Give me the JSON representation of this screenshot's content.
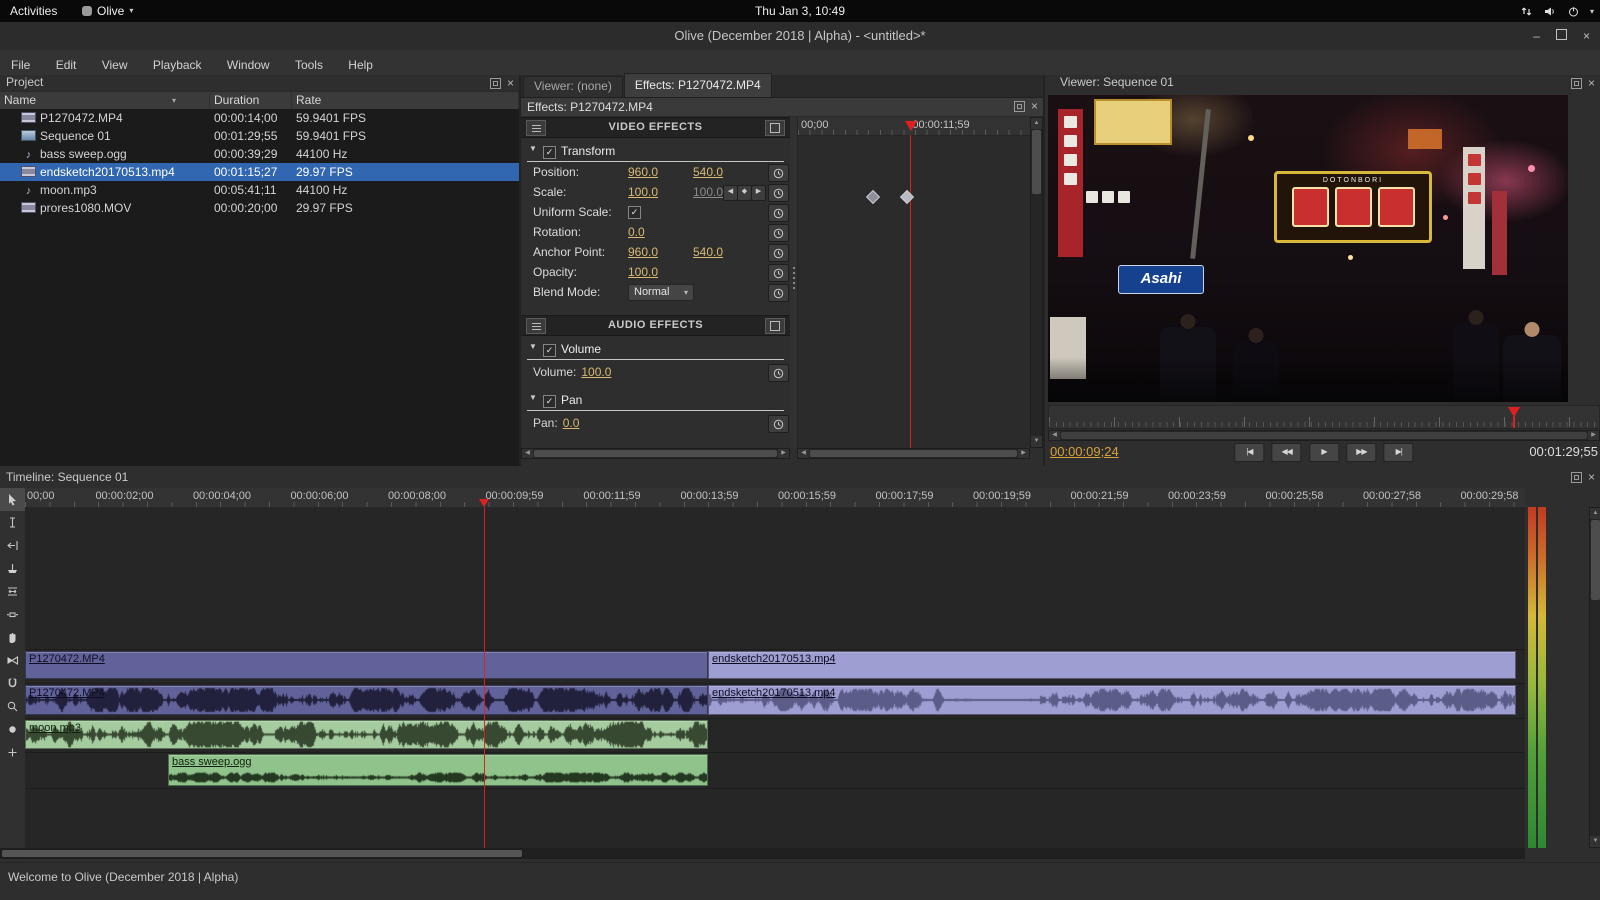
{
  "system_bar": {
    "activities_label": "Activities",
    "app_menu_label": "Olive",
    "clock": "Thu Jan 3, 10:49"
  },
  "titlebar": {
    "title": "Olive (December 2018 | Alpha) - <untitled>*"
  },
  "menu_bar": {
    "items": [
      "File",
      "Edit",
      "View",
      "Playback",
      "Window",
      "Tools",
      "Help"
    ]
  },
  "project_panel": {
    "title": "Project",
    "columns": {
      "name": "Name",
      "duration": "Duration",
      "rate": "Rate"
    },
    "items": [
      {
        "name": "P1270472.MP4",
        "duration": "00:00:14;00",
        "rate": "59.9401 FPS"
      },
      {
        "name": "Sequence 01",
        "duration": "00:01:29;55",
        "rate": "59.9401 FPS"
      },
      {
        "name": "bass sweep.ogg",
        "duration": "00:00:39;29",
        "rate": "44100 Hz"
      },
      {
        "name": "endsketch20170513.mp4",
        "duration": "00:01:15;27",
        "rate": "29.97 FPS"
      },
      {
        "name": "moon.mp3",
        "duration": "00:05:41;11",
        "rate": "44100 Hz"
      },
      {
        "name": "prores1080.MOV",
        "duration": "00:00:20;00",
        "rate": "29.97 FPS"
      }
    ],
    "selected_index": 3
  },
  "effects_panel": {
    "tabs": [
      {
        "label": "Viewer: (none)"
      },
      {
        "label": "Effects: P1270472.MP4"
      }
    ],
    "header": "Effects: P1270472.MP4",
    "video_effects_header": "VIDEO EFFECTS",
    "audio_effects_header": "AUDIO EFFECTS",
    "transform": {
      "title": "Transform",
      "position": {
        "label": "Position:",
        "x": "960.0",
        "y": "540.0"
      },
      "scale": {
        "label": "Scale:",
        "x": "100.0",
        "y": "100.0"
      },
      "uniform_scale": {
        "label": "Uniform Scale:"
      },
      "rotation": {
        "label": "Rotation:",
        "value": "0.0"
      },
      "anchor_point": {
        "label": "Anchor Point:",
        "x": "960.0",
        "y": "540.0"
      },
      "opacity": {
        "label": "Opacity:",
        "value": "100.0"
      },
      "blend_mode": {
        "label": "Blend Mode:",
        "value": "Normal"
      }
    },
    "volume": {
      "title": "Volume",
      "label": "Volume:",
      "value": "100.0"
    },
    "pan": {
      "title": "Pan",
      "label": "Pan:",
      "value": "0.0"
    },
    "keyframe_ruler": {
      "start_label": "00;00",
      "end_label": "00:00:11;59"
    }
  },
  "viewer_panel": {
    "title": "Viewer: Sequence 01",
    "current_time": "00:00:09;24",
    "total_time": "00:01:29;55",
    "transport": {
      "prev": "|◀",
      "rewind": "◀◀",
      "play": "▶",
      "forward": "▶▶",
      "next": "▶|"
    },
    "scene": {
      "sign_dotonbori": "DOTONBORI",
      "sign_asahi": "Asahi"
    }
  },
  "timeline_panel": {
    "title": "Timeline: Sequence 01",
    "ruler_labels": [
      "00;00",
      "00:00:02;00",
      "00:00:04;00",
      "00:00:06;00",
      "00:00:08;00",
      "00:00:09;59",
      "00:00:11;59",
      "00:00:13;59",
      "00:00:15;59",
      "00:00:17;59",
      "00:00:19;59",
      "00:00:21;59",
      "00:00:23;59",
      "00:00:25;58",
      "00:00:27;58",
      "00:00:29;58"
    ],
    "tools": [
      "pointer",
      "edit",
      "ripple",
      "razor",
      "slip",
      "slide",
      "hand",
      "transition",
      "snapping",
      "zoom",
      "record",
      "add"
    ],
    "clips": {
      "v1a": "P1270472.MP4",
      "v1b": "endsketch20170513.mp4",
      "v2a": "P1270472.MP4",
      "v2b": "endsketch20170513.mp4",
      "a1": "moon.mp3",
      "a2": "bass sweep.ogg"
    }
  },
  "status_bar": {
    "message": "Welcome to Olive (December 2018 | Alpha)"
  },
  "icons": {
    "close": "×",
    "window_min": "–",
    "window_close": "×",
    "chevron_down": "▾",
    "disclosure": "▼",
    "check": "✓",
    "note": "♪",
    "kf_prev": "◀",
    "kf_toggle": "◆",
    "kf_next": "▶",
    "arrow_left": "◀",
    "arrow_right": "▶",
    "arrow_up": "▲",
    "arrow_down": "▼"
  },
  "colors": {
    "selection": "#3166b0",
    "value_link": "#d9b971",
    "timecode": "#d9a13c",
    "playhead": "#e02020",
    "clip_video_dark": "#62629a",
    "clip_video_light": "#9e9ed2",
    "clip_audio_moon": "#a4cc9f",
    "clip_audio_bass": "#8fc38b"
  }
}
